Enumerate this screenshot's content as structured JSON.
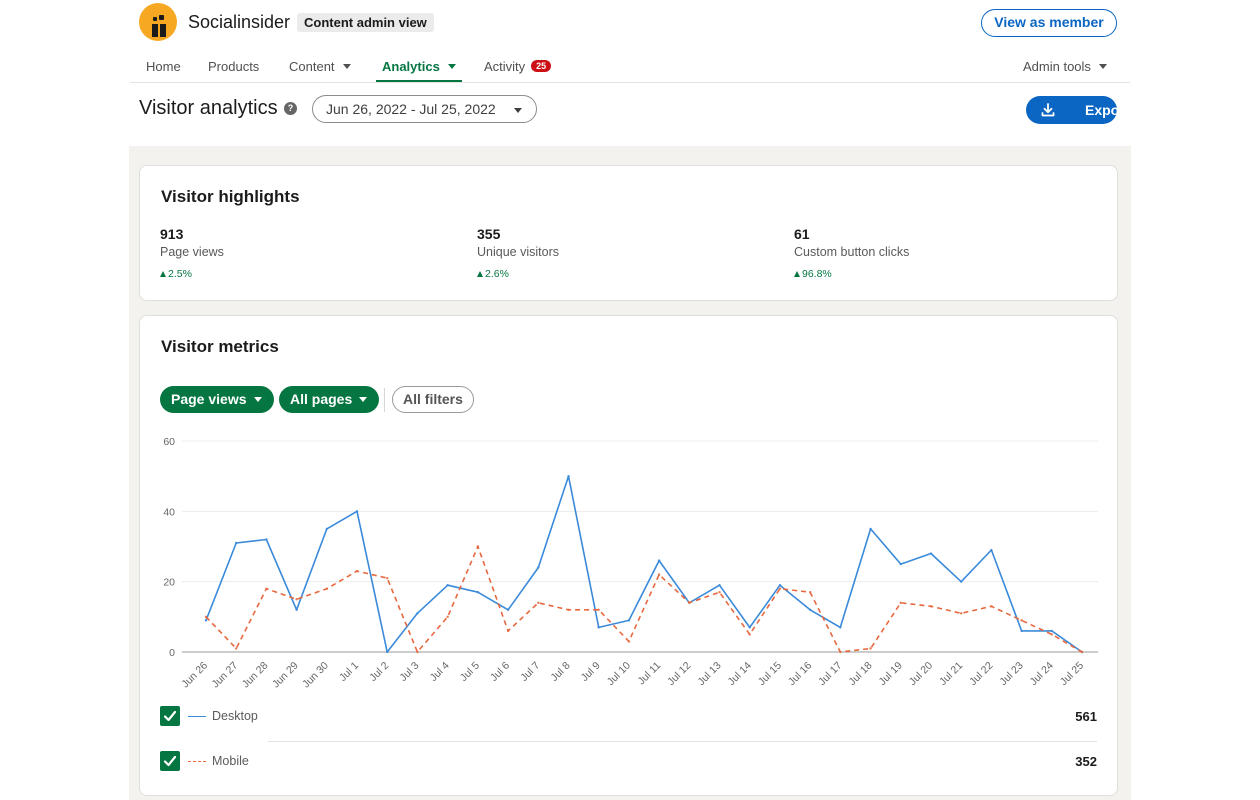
{
  "header": {
    "brand": "Socialinsider",
    "admin_badge": "Content admin view",
    "view_as_member": "View as member"
  },
  "nav": {
    "items": [
      {
        "label": "Home"
      },
      {
        "label": "Products"
      },
      {
        "label": "Content",
        "dropdown": true
      },
      {
        "label": "Analytics",
        "dropdown": true,
        "active": true
      },
      {
        "label": "Activity",
        "badge": "25"
      }
    ],
    "admin_tools": "Admin tools"
  },
  "page": {
    "title": "Visitor analytics",
    "date_range": "Jun 26, 2022 - Jul 25, 2022",
    "export_label": "Export"
  },
  "highlights": {
    "title": "Visitor highlights",
    "items": [
      {
        "value": "913",
        "label": "Page views",
        "change": "2.5%"
      },
      {
        "value": "355",
        "label": "Unique visitors",
        "change": "2.6%"
      },
      {
        "value": "61",
        "label": "Custom button clicks",
        "change": "96.8%"
      }
    ]
  },
  "metrics": {
    "title": "Visitor metrics",
    "filters": {
      "metric": "Page views",
      "pages": "All pages",
      "all_filters": "All filters"
    },
    "legend": [
      {
        "name": "Desktop",
        "total": "561",
        "color": "#3b8ad9",
        "style": "solid"
      },
      {
        "name": "Mobile",
        "total": "352",
        "color": "#e8683f",
        "style": "dashed"
      }
    ]
  },
  "chart_data": {
    "type": "line",
    "ylim": [
      0,
      60
    ],
    "yticks": [
      0,
      20,
      40,
      60
    ],
    "grid": true,
    "categories": [
      "Jun 26",
      "Jun 27",
      "Jun 28",
      "Jun 29",
      "Jun 30",
      "Jul 1",
      "Jul 2",
      "Jul 3",
      "Jul 4",
      "Jul 5",
      "Jul 6",
      "Jul 7",
      "Jul 8",
      "Jul 9",
      "Jul 10",
      "Jul 11",
      "Jul 12",
      "Jul 13",
      "Jul 14",
      "Jul 15",
      "Jul 16",
      "Jul 17",
      "Jul 18",
      "Jul 19",
      "Jul 20",
      "Jul 21",
      "Jul 22",
      "Jul 23",
      "Jul 24",
      "Jul 25"
    ],
    "series": [
      {
        "name": "Desktop",
        "color": "#3b8ad9",
        "style": "solid",
        "values": [
          9,
          31,
          32,
          12,
          35,
          40,
          0,
          11,
          19,
          17,
          12,
          24,
          50,
          7,
          9,
          26,
          14,
          19,
          7,
          19,
          12,
          7,
          35,
          25,
          28,
          20,
          29,
          6,
          6,
          0
        ]
      },
      {
        "name": "Mobile",
        "color": "#e8683f",
        "style": "dashed",
        "values": [
          10,
          1,
          18,
          15,
          18,
          23,
          21,
          0,
          10,
          30,
          6,
          14,
          12,
          12,
          3,
          22,
          14,
          17,
          5,
          18,
          17,
          0,
          1,
          14,
          13,
          11,
          13,
          9,
          5,
          0
        ]
      }
    ]
  }
}
